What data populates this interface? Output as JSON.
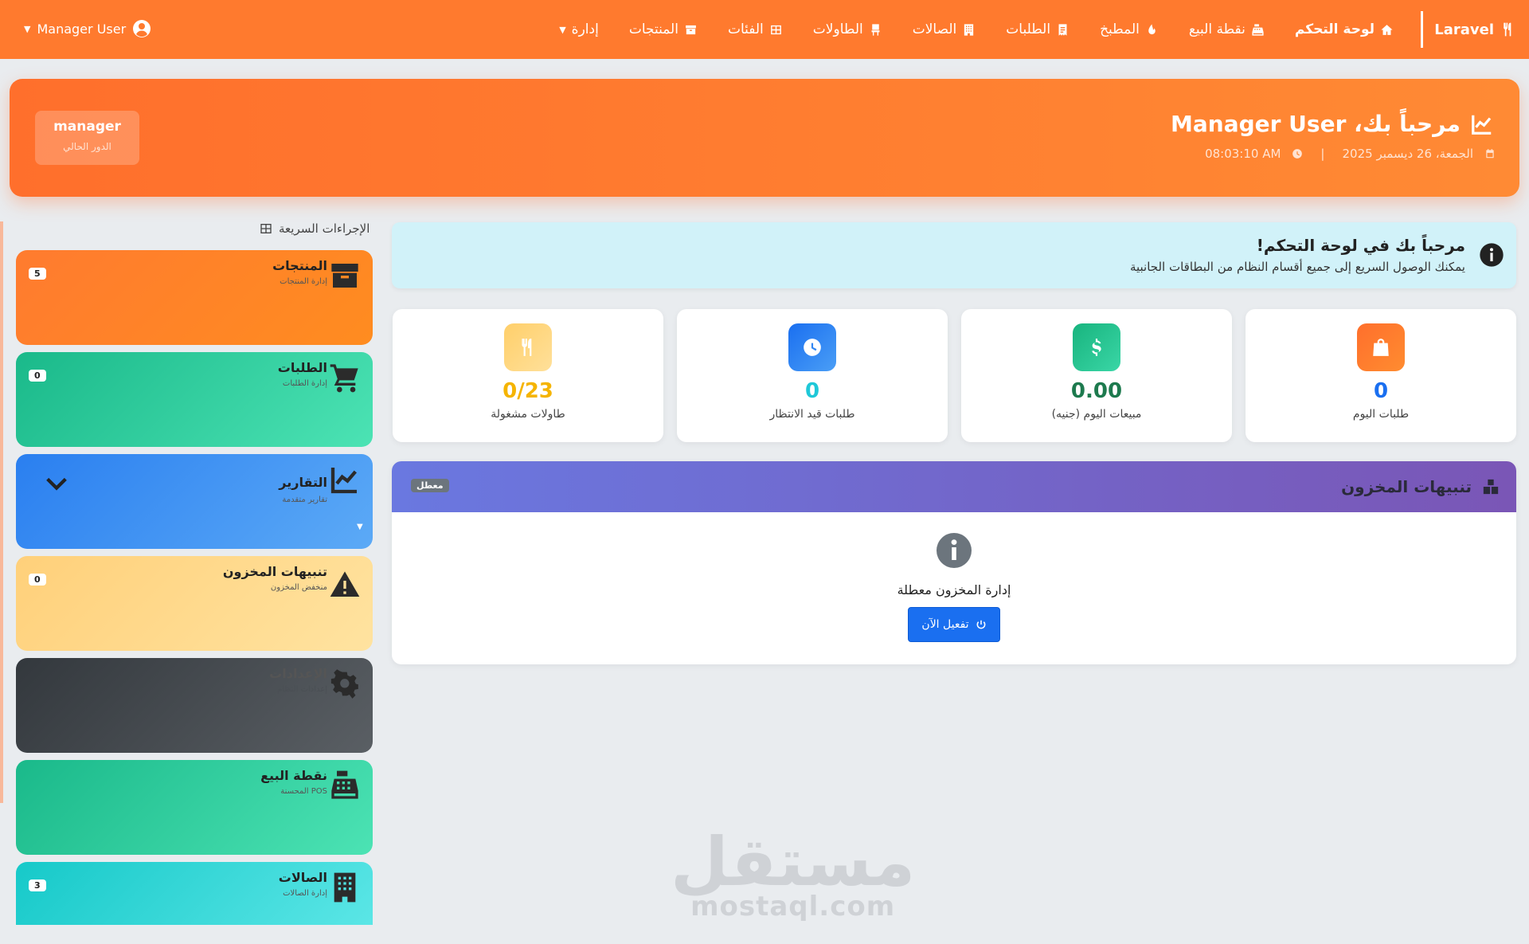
{
  "navbar": {
    "brand": "Laravel",
    "items": [
      {
        "label": "لوحة التحكم",
        "icon": "home-icon",
        "active": true
      },
      {
        "label": "نقطة البيع",
        "icon": "cash-register-icon"
      },
      {
        "label": "المطبخ",
        "icon": "fire-icon"
      },
      {
        "label": "الطلبات",
        "icon": "receipt-icon"
      },
      {
        "label": "الصالات",
        "icon": "building-icon"
      },
      {
        "label": "الطاولات",
        "icon": "chair-icon"
      },
      {
        "label": "الفئات",
        "icon": "table-grid-icon"
      },
      {
        "label": "المنتجات",
        "icon": "box-icon"
      },
      {
        "label": "إدارة",
        "icon": "caret-down-icon"
      }
    ],
    "user": "Manager User"
  },
  "hero": {
    "title": "مرحباً بك، Manager User",
    "date": "الجمعة، 26 ديسمبر 2025",
    "separator": "|",
    "time": "08:03:10 AM",
    "role": "manager",
    "role_label": "الدور الحالي"
  },
  "sidebar": {
    "title": "الإجراءات السريعة",
    "cards": [
      {
        "title": "المنتجات",
        "sub": "إدارة المنتجات",
        "badge": "5",
        "icon": "box-icon"
      },
      {
        "title": "الطلبات",
        "sub": "إدارة الطلبات",
        "badge": "0",
        "icon": "cart-icon"
      },
      {
        "title": "التقارير",
        "sub": "تقارير متقدمة",
        "badge": "",
        "icon": "chart-line-icon"
      },
      {
        "title": "تنبيهات المخزون",
        "sub": "منخفض المخزون",
        "badge": "0",
        "icon": "warning-icon"
      },
      {
        "title": "الإعدادات",
        "sub": "إعدادات النظام",
        "badge": "",
        "icon": "gear-icon"
      },
      {
        "title": "نقطة البيع",
        "sub": "POS المحسنة",
        "badge": "",
        "icon": "cash-register-icon"
      },
      {
        "title": "الصالات",
        "sub": "إدارة الصالات",
        "badge": "3",
        "icon": "building-icon"
      }
    ]
  },
  "info": {
    "title": "مرحباً بك في لوحة التحكم!",
    "text": "يمكنك الوصول السريع إلى جميع أقسام النظام من البطاقات الجانبية"
  },
  "stats": [
    {
      "value": "0",
      "label": "طلبات اليوم",
      "color": "#1a6ff0",
      "icon": "bag-icon"
    },
    {
      "value": "0.00",
      "label": "مبيعات اليوم (جنيه)",
      "color": "#198754",
      "icon": "dollar-icon"
    },
    {
      "value": "0",
      "label": "طلبات قيد الانتظار",
      "color": "#1fc8d8",
      "icon": "clock-icon"
    },
    {
      "value": "0/23",
      "label": "طاولات مشغولة",
      "color": "#f5b400",
      "icon": "utensils-icon"
    }
  ],
  "inventory": {
    "title": "تنبيهات المخزون",
    "tag": "معطل",
    "message": "إدارة المخزون معطلة",
    "button": "تفعيل الآن"
  },
  "watermark": {
    "line1": "مستقل",
    "line2": "mostaql.com"
  }
}
